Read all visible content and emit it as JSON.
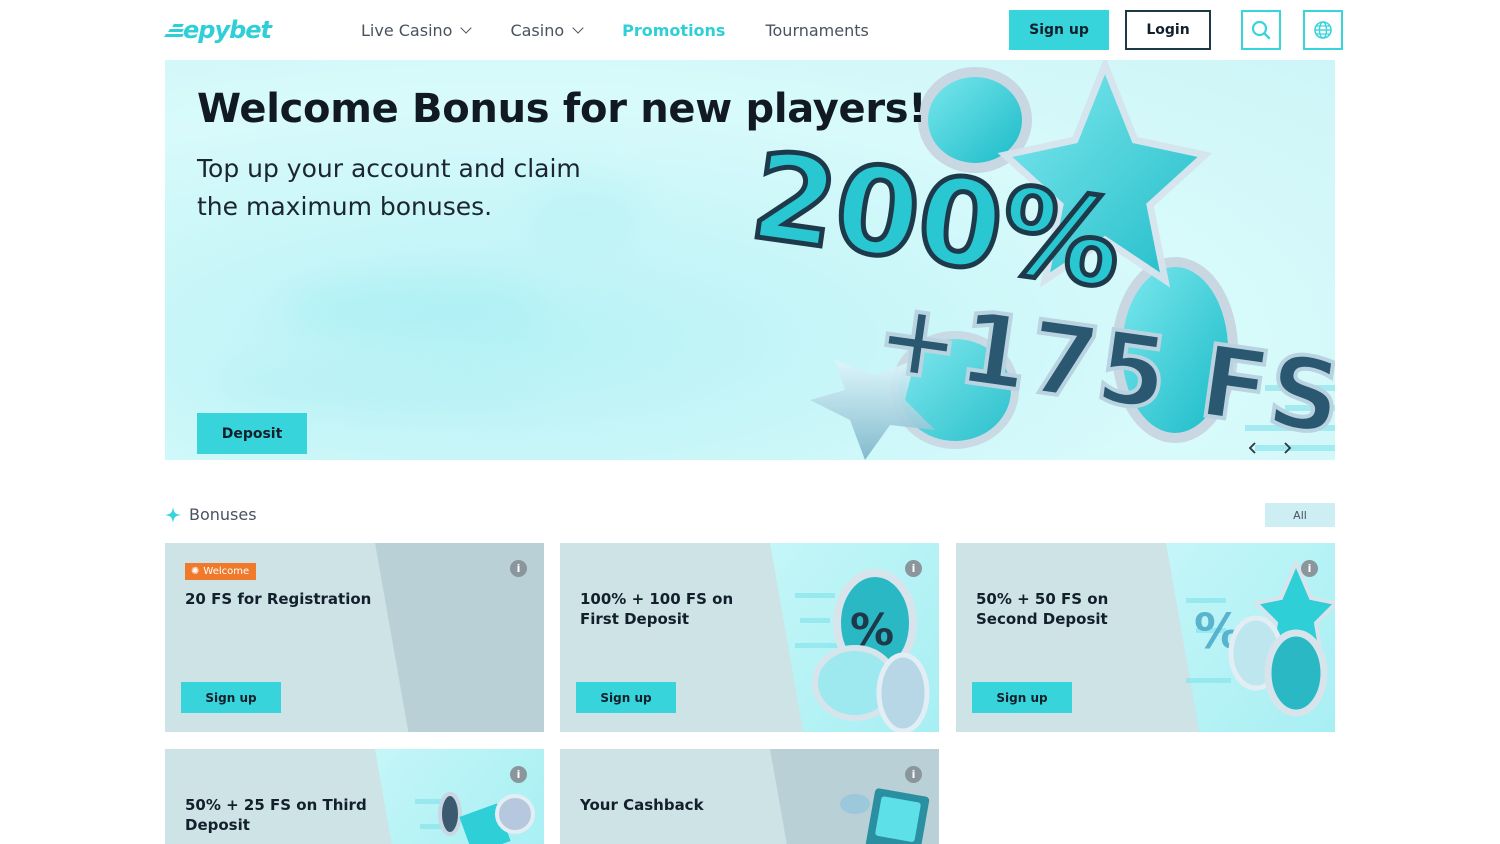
{
  "header": {
    "logo": "epybet",
    "nav": [
      {
        "label": "Live Casino",
        "has_dropdown": true
      },
      {
        "label": "Casino",
        "has_dropdown": true
      },
      {
        "label": "Promotions",
        "active": true
      },
      {
        "label": "Tournaments"
      }
    ],
    "signup_label": "Sign up",
    "login_label": "Login",
    "icons": [
      "search-icon",
      "globe-icon"
    ]
  },
  "hero": {
    "title": "Welcome Bonus for new players!",
    "subtitle": "Top up your account and claim the maximum bonuses.",
    "art_text_1": "200%",
    "art_text_2": "+175 FS",
    "deposit_label": "Deposit"
  },
  "bonuses": {
    "title": "Bonuses",
    "all_label": "All",
    "cards": [
      {
        "badge": "Welcome",
        "title": "20 FS for Registration",
        "button": "Sign up"
      },
      {
        "title": "100% + 100 FS on First Deposit",
        "button": "Sign up"
      },
      {
        "title": "50% + 50 FS on Second Deposit",
        "button": "Sign up"
      },
      {
        "title": "50% + 25 FS on Third Deposit"
      },
      {
        "title": "Your Cashback"
      }
    ]
  },
  "colors": {
    "accent": "#37d4dc",
    "dark": "#13202b",
    "card_bg": "#cde3e6",
    "badge": "#f07a2c"
  }
}
